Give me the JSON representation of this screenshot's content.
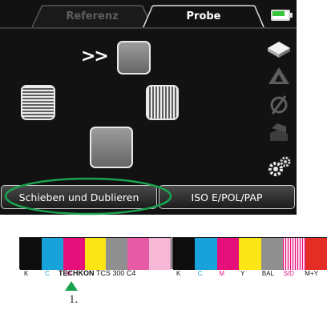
{
  "tabs": [
    {
      "label": "Referenz",
      "active": false
    },
    {
      "label": "Probe",
      "active": true
    }
  ],
  "battery": {
    "level": 0.75,
    "color": "#35c53a"
  },
  "canvas": {
    "move_indicator": ">>"
  },
  "side_icons": [
    "cube-icon",
    "triangle-icon",
    "circle-slash-icon",
    "stacked-shapes-icon",
    "gears-icon"
  ],
  "bottom_buttons": [
    {
      "label": "Schieben und Dublieren"
    },
    {
      "label": "ISO E/POL/PAP"
    }
  ],
  "highlight_color": "#1aa24e",
  "strip_left": {
    "patches": [
      "#0d0d0d",
      "#17a3da",
      "#e5107a",
      "#fbe514",
      "#8f8f8f",
      "#e75aa5",
      "#f7b8d6"
    ],
    "labels": [
      "K",
      "C",
      "M"
    ],
    "label_colors": [
      "#111111",
      "#17a3da",
      "#e5107a"
    ],
    "brand": "TECHKON",
    "brand_suffix": "TCS 300 C4"
  },
  "strip_right": {
    "patches": [
      "#0d0d0d",
      "#17a3da",
      "#e5107a",
      "#fbe514",
      "#8f8f8f",
      "stripes",
      "#e42d24"
    ],
    "labels": [
      "K",
      "C",
      "M",
      "Y",
      "BAL",
      "S/D",
      "M+Y"
    ],
    "label_colors": [
      "#111111",
      "#17a3da",
      "#e5107a",
      "#111111",
      "#111111",
      "#e5107a",
      "#111111"
    ]
  },
  "marker": {
    "number": "1."
  }
}
